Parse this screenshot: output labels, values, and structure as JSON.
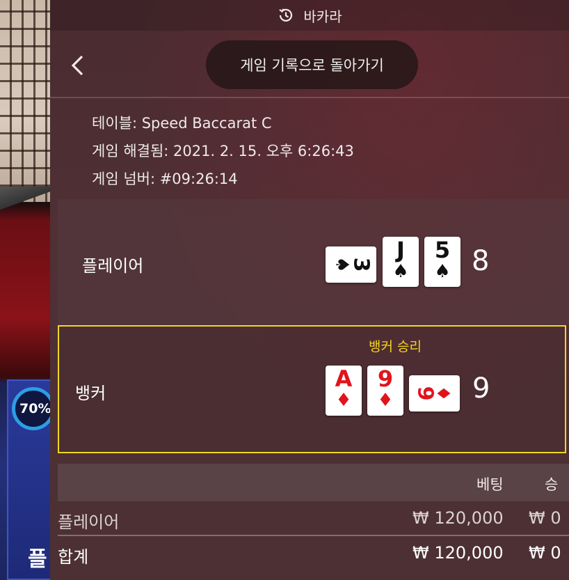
{
  "background": {
    "percent_badge": "70%",
    "bottom_char": "플"
  },
  "header": {
    "title": "바카라",
    "history_icon": "history-clock-icon"
  },
  "nav": {
    "back_icon": "chevron-left-icon",
    "back_to_history_label": "게임 기록으로 돌아가기"
  },
  "game_info": {
    "table": "테이블: Speed Baccarat C",
    "resolved": "게임 해결됨: 2021. 2. 15. 오후 6:26:43",
    "number": "게임 넘버: #09:26:14"
  },
  "hands": {
    "player": {
      "label": "플레이어",
      "score": "8",
      "cards": [
        {
          "rank": "3",
          "suit": "♠",
          "color": "black",
          "orientation": "horizontal"
        },
        {
          "rank": "J",
          "suit": "♠",
          "color": "black",
          "orientation": "vertical"
        },
        {
          "rank": "5",
          "suit": "♠",
          "color": "black",
          "orientation": "vertical"
        }
      ]
    },
    "banker": {
      "label": "뱅커",
      "score": "9",
      "win_label": "뱅커 승리",
      "cards": [
        {
          "rank": "A",
          "suit": "♦",
          "color": "red",
          "orientation": "vertical"
        },
        {
          "rank": "9",
          "suit": "♦",
          "color": "red",
          "orientation": "vertical"
        },
        {
          "rank": "9",
          "suit": "♦",
          "color": "red",
          "orientation": "horizontal"
        }
      ]
    }
  },
  "bets_table": {
    "headers": {
      "bet": "베팅",
      "win": "승"
    },
    "rows": [
      {
        "name": "플레이어",
        "bet": "₩ 120,000",
        "win": "₩ 0"
      }
    ],
    "total": {
      "name": "합계",
      "bet": "₩ 120,000",
      "win": "₩ 0"
    }
  },
  "colors": {
    "win_highlight": "#f2d81e",
    "card_red": "#e1141c",
    "card_black": "#111111"
  }
}
